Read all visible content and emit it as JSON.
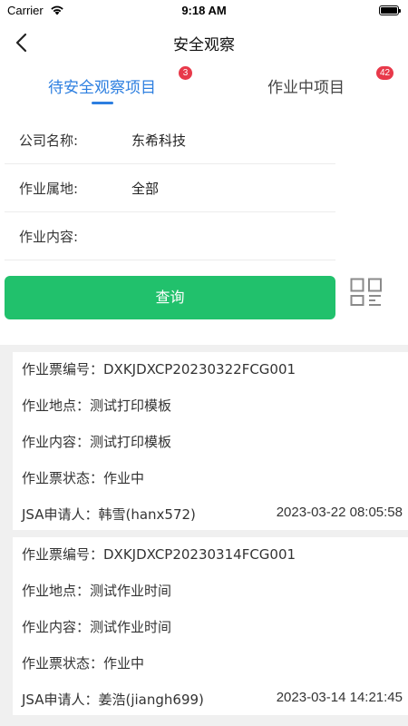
{
  "status_bar": {
    "carrier": "Carrier",
    "time": "9:18 AM"
  },
  "nav": {
    "title": "安全观察"
  },
  "tabs": [
    {
      "label": "待安全观察项目",
      "badge": "3",
      "active": true
    },
    {
      "label": "作业中项目",
      "badge": "42",
      "active": false
    }
  ],
  "filters": [
    {
      "label": "公司名称:",
      "value": "东希科技"
    },
    {
      "label": "作业属地:",
      "value": "全部"
    },
    {
      "label": "作业内容:",
      "value": ""
    }
  ],
  "query_label": "查询",
  "cards": [
    {
      "ticket_no": "作业票编号：DXKJDXCP20230322FCG001",
      "location": "作业地点：测试打印模板",
      "content": "作业内容：测试打印模板",
      "status": "作业票状态：作业中",
      "applicant": "JSA申请人：韩雪(hanx572)",
      "time": "2023-03-22 08:05:58"
    },
    {
      "ticket_no": "作业票编号：DXKJDXCP20230314FCG001",
      "location": "作业地点：测试作业时间",
      "content": "作业内容：测试作业时间",
      "status": "作业票状态：作业中",
      "applicant": "JSA申请人：姜浩(jiangh699)",
      "time": "2023-03-14 14:21:45"
    }
  ]
}
